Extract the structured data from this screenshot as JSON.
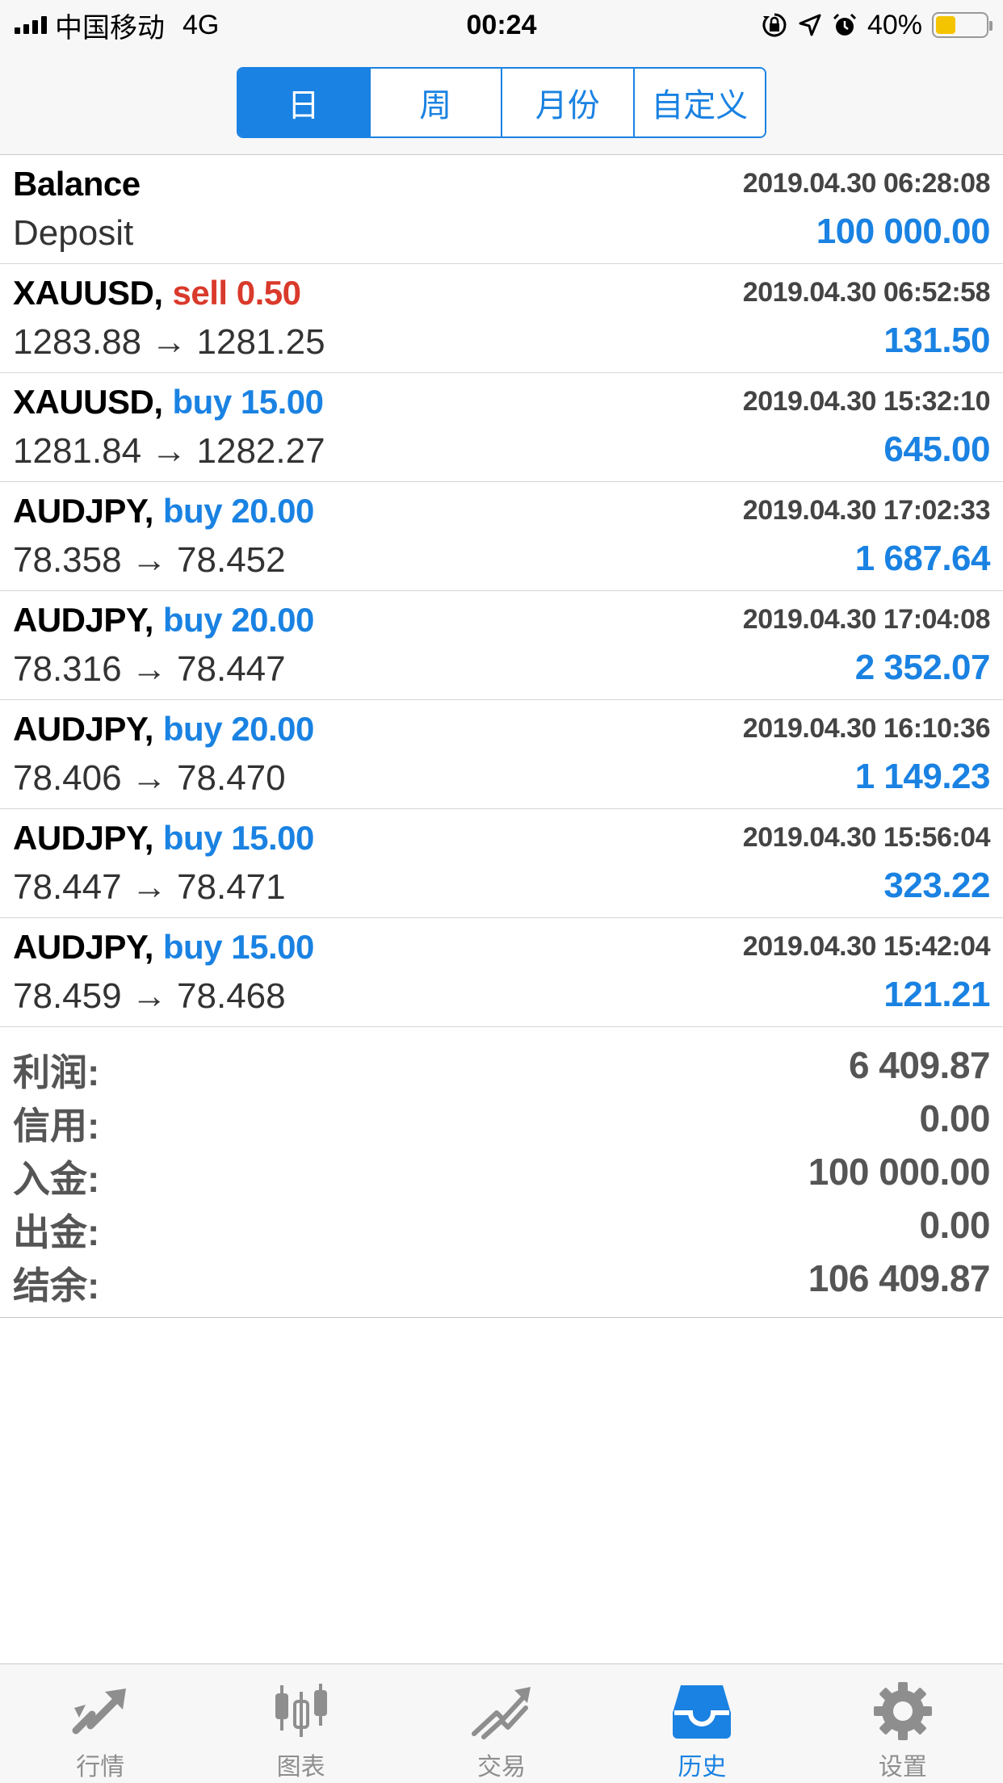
{
  "status": {
    "carrier": "中国移动",
    "network": "4G",
    "time": "00:24",
    "battery": "40%",
    "battery_level": 0.4,
    "battery_color": "#f5c400"
  },
  "segments": [
    {
      "label": "日",
      "active": true
    },
    {
      "label": "周",
      "active": false
    },
    {
      "label": "月份",
      "active": false
    },
    {
      "label": "自定义",
      "active": false
    }
  ],
  "balance": {
    "title": "Balance",
    "time": "2019.04.30 06:28:08",
    "type": "Deposit",
    "amount": "100 000.00"
  },
  "trades": [
    {
      "symbol": "XAUUSD,",
      "action": "sell 0.50",
      "side": "sell",
      "time": "2019.04.30 06:52:58",
      "prices": "1283.88 → 1281.25",
      "profit": "131.50"
    },
    {
      "symbol": "XAUUSD,",
      "action": "buy 15.00",
      "side": "buy",
      "time": "2019.04.30 15:32:10",
      "prices": "1281.84 → 1282.27",
      "profit": "645.00"
    },
    {
      "symbol": "AUDJPY,",
      "action": "buy 20.00",
      "side": "buy",
      "time": "2019.04.30 17:02:33",
      "prices": "78.358 → 78.452",
      "profit": "1 687.64"
    },
    {
      "symbol": "AUDJPY,",
      "action": "buy 20.00",
      "side": "buy",
      "time": "2019.04.30 17:04:08",
      "prices": "78.316 → 78.447",
      "profit": "2 352.07"
    },
    {
      "symbol": "AUDJPY,",
      "action": "buy 20.00",
      "side": "buy",
      "time": "2019.04.30 16:10:36",
      "prices": "78.406 → 78.470",
      "profit": "1 149.23"
    },
    {
      "symbol": "AUDJPY,",
      "action": "buy 15.00",
      "side": "buy",
      "time": "2019.04.30 15:56:04",
      "prices": "78.447 → 78.471",
      "profit": "323.22"
    },
    {
      "symbol": "AUDJPY,",
      "action": "buy 15.00",
      "side": "buy",
      "time": "2019.04.30 15:42:04",
      "prices": "78.459 → 78.468",
      "profit": "121.21"
    }
  ],
  "summary": [
    {
      "label": "利润:",
      "value": "6 409.87"
    },
    {
      "label": "信用:",
      "value": "0.00"
    },
    {
      "label": "入金:",
      "value": "100 000.00"
    },
    {
      "label": "出金:",
      "value": "0.00"
    },
    {
      "label": "结余:",
      "value": "106 409.87"
    }
  ],
  "tabs": [
    {
      "label": "行情",
      "icon": "quotes-icon",
      "active": false
    },
    {
      "label": "图表",
      "icon": "chart-icon",
      "active": false
    },
    {
      "label": "交易",
      "icon": "trade-icon",
      "active": false
    },
    {
      "label": "历史",
      "icon": "history-icon",
      "active": true
    },
    {
      "label": "设置",
      "icon": "settings-icon",
      "active": false
    }
  ],
  "colors": {
    "accent": "#1a82e2",
    "sell": "#d93a2b",
    "inactive": "#8e8e8e"
  }
}
